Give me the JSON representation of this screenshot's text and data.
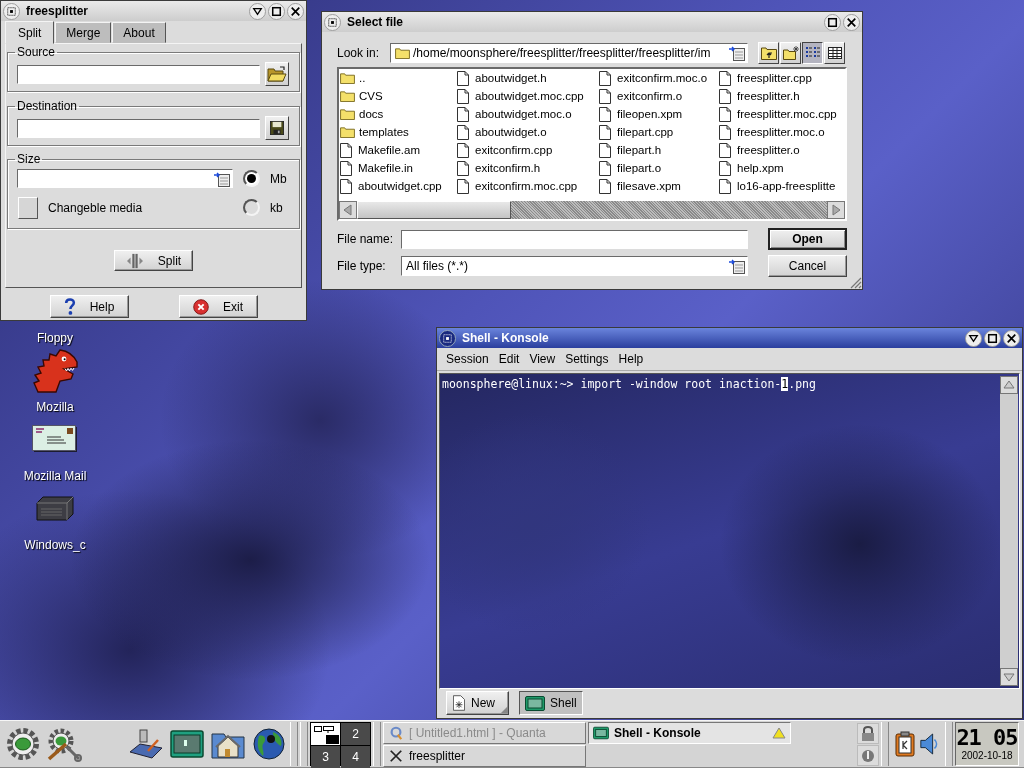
{
  "desktop_icons": [
    {
      "label": "Floppy"
    },
    {
      "label": "Mozilla",
      "kind": "mozilla"
    },
    {
      "label": "Mozilla Mail",
      "kind": "mail"
    },
    {
      "label": "Windows_c",
      "kind": "drive"
    }
  ],
  "freesplitter": {
    "title": "freesplitter",
    "tabs": [
      {
        "label": "Split",
        "selected": true
      },
      {
        "label": "Merge",
        "selected": false
      },
      {
        "label": "About",
        "selected": false
      }
    ],
    "source": {
      "label": "Source"
    },
    "destination": {
      "label": "Destination"
    },
    "size": {
      "label": "Size",
      "changeable_media": {
        "label": "Changeble media",
        "checked": false
      },
      "units": [
        {
          "label": "Mb",
          "selected": true
        },
        {
          "label": "kb",
          "selected": false
        }
      ]
    },
    "split_button": "Split",
    "buttons": [
      {
        "label": "Help",
        "kind": "help"
      },
      {
        "label": "Exit",
        "kind": "exit"
      }
    ]
  },
  "file_dialog": {
    "title": "Select file",
    "look_in_label": "Look in:",
    "path": "/home/moonsphere/freesplitter/freesplitter/freesplitter/im",
    "view_modes": [
      {
        "kind": "short",
        "selected": true
      },
      {
        "kind": "detailed",
        "selected": false
      }
    ],
    "files": [
      {
        "name": "..",
        "kind": "folder"
      },
      {
        "name": "CVS",
        "kind": "folder"
      },
      {
        "name": "docs",
        "kind": "folder"
      },
      {
        "name": "templates",
        "kind": "folder"
      },
      {
        "name": "Makefile.am",
        "kind": "file"
      },
      {
        "name": "Makefile.in",
        "kind": "file"
      },
      {
        "name": "aboutwidget.cpp",
        "kind": "file"
      },
      {
        "name": "aboutwidget.h",
        "kind": "file"
      },
      {
        "name": "aboutwidget.moc.cpp",
        "kind": "file"
      },
      {
        "name": "aboutwidget.moc.o",
        "kind": "file"
      },
      {
        "name": "aboutwidget.o",
        "kind": "file"
      },
      {
        "name": "exitconfirm.cpp",
        "kind": "file"
      },
      {
        "name": "exitconfirm.h",
        "kind": "file"
      },
      {
        "name": "exitconfirm.moc.cpp",
        "kind": "file"
      },
      {
        "name": "exitconfirm.moc.o",
        "kind": "file"
      },
      {
        "name": "exitconfirm.o",
        "kind": "file"
      },
      {
        "name": "fileopen.xpm",
        "kind": "file"
      },
      {
        "name": "filepart.cpp",
        "kind": "file"
      },
      {
        "name": "filepart.h",
        "kind": "file"
      },
      {
        "name": "filepart.o",
        "kind": "file"
      },
      {
        "name": "filesave.xpm",
        "kind": "file"
      },
      {
        "name": "freesplitter.cpp",
        "kind": "file"
      },
      {
        "name": "freesplitter.h",
        "kind": "file"
      },
      {
        "name": "freesplitter.moc.cpp",
        "kind": "file"
      },
      {
        "name": "freesplitter.moc.o",
        "kind": "file"
      },
      {
        "name": "freesplitter.o",
        "kind": "file"
      },
      {
        "name": "help.xpm",
        "kind": "file"
      },
      {
        "name": "lo16-app-freesplitte",
        "kind": "file"
      }
    ],
    "file_name_label": "File name:",
    "file_type_label": "File type:",
    "file_type": "All files (*.*)",
    "buttons": [
      {
        "label": "Open",
        "default": true
      },
      {
        "label": "Cancel",
        "default": false
      }
    ]
  },
  "konsole": {
    "title": "Shell - Konsole",
    "menu": [
      "Session",
      "Edit",
      "View",
      "Settings",
      "Help"
    ],
    "terminal": {
      "before_cursor": "moonsphere@linux:~> import -window root inaction-",
      "cursor": "1",
      "after_cursor": ".png"
    },
    "new_button": "New",
    "sessions": [
      {
        "label": "Shell",
        "selected": true
      }
    ]
  },
  "taskbar": {
    "pager": [
      {
        "selected": true
      },
      {
        "label": "2",
        "selected": false
      },
      {
        "label": "3",
        "selected": false
      },
      {
        "label": "4",
        "selected": false
      }
    ],
    "tasks": [
      {
        "label": "[ Untitled1.html ] - Quanta",
        "kind": "quanta",
        "selected": false,
        "minimized": true
      },
      {
        "label": "freesplitter",
        "kind": "x11",
        "selected": false,
        "minimized": false
      },
      {
        "label": "Shell - Konsole",
        "kind": "terminal",
        "selected": true,
        "minimized": false
      }
    ],
    "clock": {
      "time": "21 05",
      "date": "2002-10-18"
    }
  }
}
